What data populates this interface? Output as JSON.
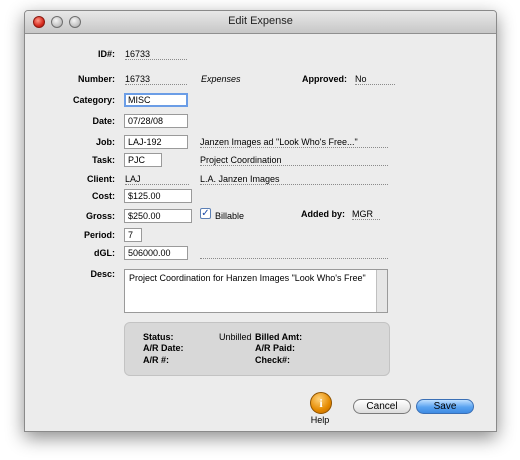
{
  "window": {
    "title": "Edit Expense"
  },
  "form": {
    "id": {
      "label": "ID#:",
      "value": "16733"
    },
    "number": {
      "label": "Number:",
      "value": "16733",
      "note": "Expenses"
    },
    "approved": {
      "label": "Approved:",
      "value": "No"
    },
    "category": {
      "label": "Category:",
      "value": "MISC"
    },
    "date": {
      "label": "Date:",
      "value": "07/28/08"
    },
    "job": {
      "label": "Job:",
      "value": "LAJ-192",
      "description": "Janzen Images ad \"Look Who's Free...\""
    },
    "task": {
      "label": "Task:",
      "value": "PJC",
      "description": "Project Coordination"
    },
    "client": {
      "label": "Client:",
      "value": "LAJ",
      "description": "L.A. Janzen Images"
    },
    "cost": {
      "label": "Cost:",
      "value": "$125.00"
    },
    "gross": {
      "label": "Gross:",
      "value": "$250.00"
    },
    "billable": {
      "label": "Billable",
      "checked": true,
      "mark": "✓"
    },
    "added_by": {
      "label": "Added by:",
      "value": "MGR"
    },
    "period": {
      "label": "Period:",
      "value": "7"
    },
    "dgl": {
      "label": "dGL:",
      "value": "506000.00"
    },
    "desc": {
      "label": "Desc:",
      "value": "Project Coordination for Hanzen Images \"Look Who's Free\""
    }
  },
  "billing": {
    "status_label": "Status:",
    "status_value": "Unbilled",
    "ar_date_label": "A/R Date:",
    "ar_num_label": "A/R #:",
    "billed_amt_label": "Billed Amt:",
    "ar_paid_label": "A/R Paid:",
    "check_label": "Check#:"
  },
  "actions": {
    "help_glyph": "i",
    "help_label": "Help",
    "cancel_label": "Cancel",
    "save_label": "Save"
  }
}
